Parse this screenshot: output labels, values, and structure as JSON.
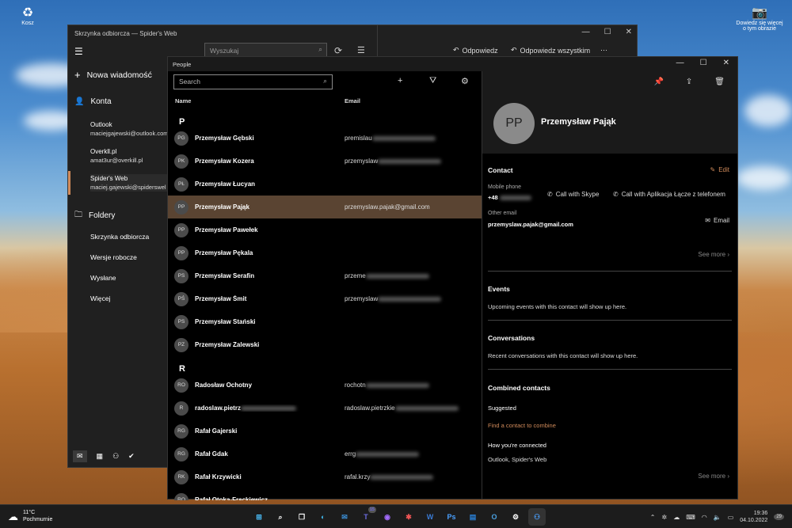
{
  "desktop": {
    "recycle_label": "Kosz",
    "camera_label_1": "Dowiedz się więcej",
    "camera_label_2": "o tym obrazie"
  },
  "mail": {
    "title": "Skrzynka odbiorcza — Spider's Web",
    "new_message": "Nowa wiadomość",
    "accounts_header": "Konta",
    "accounts": [
      {
        "name": "Outlook",
        "email": "maciejgajewski@outlook.com"
      },
      {
        "name": "Overkll.pl",
        "email": "amat3ur@overkill.pl"
      },
      {
        "name": "Spider's Web",
        "email": "maciej.gajewski@spiderswel"
      }
    ],
    "folders_header": "Foldery",
    "folders": [
      "Skrzynka odbiorcza",
      "Wersje robocze",
      "Wysłane",
      "Więcej"
    ],
    "search_placeholder": "Wyszukaj",
    "reply": "Odpowiedz",
    "reply_all": "Odpowiedz wszystkim",
    "more": "⋯"
  },
  "people": {
    "title": "People",
    "search_placeholder": "Search",
    "col_name": "Name",
    "col_email": "Email",
    "groups": [
      {
        "letter": "P",
        "contacts": [
          {
            "initials": "PG",
            "name": "Przemysław Gębski",
            "email": "premislau",
            "blurred": true
          },
          {
            "initials": "PK",
            "name": "Przemysław Kozera",
            "email": "przemyslaw",
            "blurred": true
          },
          {
            "initials": "PŁ",
            "name": "Przemysław Łucyan",
            "email": "",
            "blurred": false
          },
          {
            "initials": "PP",
            "name": "Przemysław Pająk",
            "email": "przemyslaw.pajak@gmail.com",
            "blurred": false,
            "selected": true
          },
          {
            "initials": "PP",
            "name": "Przemysław Pawełek",
            "email": "",
            "blurred": false
          },
          {
            "initials": "PP",
            "name": "Przemysław Pękala",
            "email": "",
            "blurred": false
          },
          {
            "initials": "PS",
            "name": "Przemysław Serafin",
            "email": "przeme",
            "blurred": true
          },
          {
            "initials": "PŚ",
            "name": "Przemysław Śmit",
            "email": "przemyslaw",
            "blurred": true
          },
          {
            "initials": "PS",
            "name": "Przemysław Stański",
            "email": "",
            "blurred": false
          },
          {
            "initials": "PZ",
            "name": "Przemysław Zalewski",
            "email": "",
            "blurred": false
          }
        ]
      },
      {
        "letter": "R",
        "contacts": [
          {
            "initials": "RO",
            "name": "Radosław Ochotny",
            "email": "rochotn",
            "blurred": true
          },
          {
            "initials": "R",
            "name": "radoslaw.pietrz",
            "email": "radoslaw.pietrzkie",
            "blurred": true,
            "name_blurred": true
          },
          {
            "initials": "RG",
            "name": "Rafał Gajerski",
            "email": "",
            "blurred": false
          },
          {
            "initials": "RG",
            "name": "Rafał Gdak",
            "email": "errg",
            "blurred": true
          },
          {
            "initials": "RK",
            "name": "Rafał Krzywicki",
            "email": "rafal.krzy",
            "blurred": true
          },
          {
            "initials": "RO",
            "name": "Rafał Otoka-Frąckiewicz",
            "email": "",
            "blurred": false
          }
        ]
      }
    ],
    "detail": {
      "initials": "PP",
      "name": "Przemysław Pająk",
      "contact_header": "Contact",
      "edit": "Edit",
      "mobile_label": "Mobile phone",
      "mobile_value": "+48",
      "call_skype": "Call with Skype",
      "call_phone": "Call with Aplikacja Łącze z telefonem",
      "other_email_label": "Other email",
      "other_email_value": "przemyslaw.pajak@gmail.com",
      "email_action": "Email",
      "see_more": "See more",
      "events_header": "Events",
      "events_text": "Upcoming events with this contact will show up here.",
      "conversations_header": "Conversations",
      "conversations_text": "Recent conversations with this contact will show up here.",
      "combined_header": "Combined contacts",
      "suggested": "Suggested",
      "find_combine": "Find a contact to combine",
      "how_connected": "How you're connected",
      "connected_value": "Outlook, Spider's Web",
      "see_more_2": "See more"
    }
  },
  "taskbar": {
    "temp": "11°C",
    "weather": "Pochmurnie",
    "time": "19:36",
    "date": "04.10.2022",
    "badge": "15",
    "notif": "29"
  }
}
